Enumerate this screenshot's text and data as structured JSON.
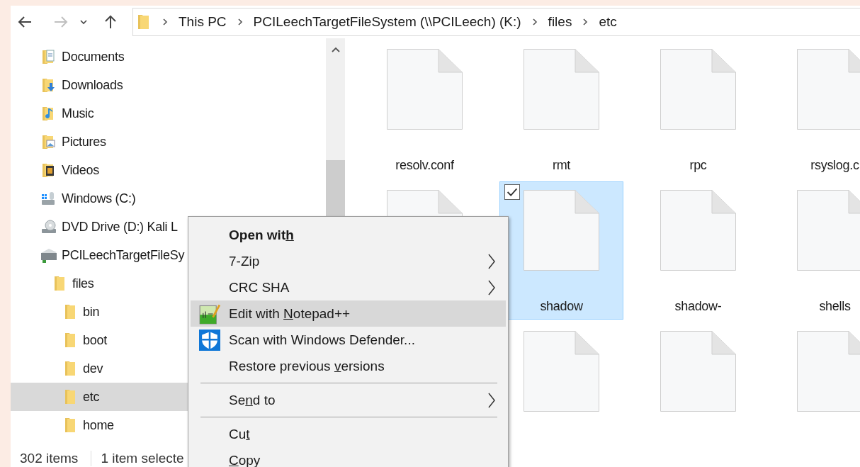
{
  "navigation": {
    "back_disabled": false,
    "forward_disabled": true,
    "breadcrumbs": [
      "This PC",
      "PCILeechTargetFileSystem (\\\\PCILeech) (K:)",
      "files",
      "etc"
    ]
  },
  "sidebar": {
    "items": [
      {
        "label": "Documents",
        "kind": "documents",
        "selected": false
      },
      {
        "label": "Downloads",
        "kind": "downloads",
        "selected": false
      },
      {
        "label": "Music",
        "kind": "music",
        "selected": false
      },
      {
        "label": "Pictures",
        "kind": "pictures",
        "selected": false
      },
      {
        "label": "Videos",
        "kind": "videos",
        "selected": false
      },
      {
        "label": "Windows (C:)",
        "kind": "system-drive",
        "selected": false
      },
      {
        "label": "DVD Drive (D:) Kali L",
        "kind": "dvd",
        "selected": false
      },
      {
        "label": "PCILeechTargetFileSy",
        "kind": "network-drive",
        "selected": false,
        "children": [
          {
            "label": "files",
            "kind": "folder",
            "selected": false,
            "children": [
              {
                "label": "bin",
                "kind": "folder",
                "selected": false
              },
              {
                "label": "boot",
                "kind": "folder",
                "selected": false
              },
              {
                "label": "dev",
                "kind": "folder",
                "selected": false
              },
              {
                "label": "etc",
                "kind": "folder",
                "selected": true
              },
              {
                "label": "home",
                "kind": "folder",
                "selected": false
              }
            ]
          }
        ]
      }
    ]
  },
  "files": [
    [
      {
        "name": "resolv.conf",
        "selected": false
      },
      {
        "name": "rmt",
        "selected": false
      },
      {
        "name": "rpc",
        "selected": false
      },
      {
        "name": "rsyslog.c",
        "selected": false
      }
    ],
    [
      {
        "selected": false
      },
      {
        "name": "shadow",
        "selected": true
      },
      {
        "name": "shadow-",
        "selected": false
      },
      {
        "name": "shells",
        "selected": false
      }
    ],
    [
      {
        "selected": false
      },
      {
        "selected": false
      },
      {
        "selected": false
      }
    ]
  ],
  "status_bar": {
    "item_count": "302 items",
    "selection": "1 item selecte"
  },
  "context_menu": {
    "items": [
      {
        "kind": "item",
        "text_before": "Open wit",
        "access_key": "h",
        "bold": true,
        "submenu": false,
        "selected": false
      },
      {
        "kind": "item",
        "text_before": "7-Zip",
        "bold": false,
        "submenu": true,
        "selected": false
      },
      {
        "kind": "item",
        "text_before": "CRC SHA",
        "bold": false,
        "submenu": true,
        "selected": false
      },
      {
        "kind": "notepad",
        "text_before": "Edit with ",
        "access_key": "N",
        "text_after": "otepad++",
        "bold": false,
        "submenu": false,
        "selected": true
      },
      {
        "kind": "antivirus",
        "text_before": "Scan with Windows Defender...",
        "bold": false,
        "submenu": false,
        "selected": false
      },
      {
        "kind": "item",
        "text_before": "Restore previous ",
        "access_key": "v",
        "text_after": "ersions",
        "bold": false,
        "submenu": false,
        "selected": false
      },
      {
        "kind": "separator"
      },
      {
        "kind": "item",
        "text_before": "Se",
        "access_key": "n",
        "text_after": "d to",
        "bold": false,
        "submenu": true,
        "selected": false
      },
      {
        "kind": "separator"
      },
      {
        "kind": "item",
        "text_before": "Cu",
        "access_key": "t",
        "bold": false,
        "submenu": false,
        "selected": false
      },
      {
        "kind": "item",
        "access_key": "C",
        "text_after": "opy",
        "bold": false,
        "submenu": false,
        "selected": false
      }
    ]
  }
}
